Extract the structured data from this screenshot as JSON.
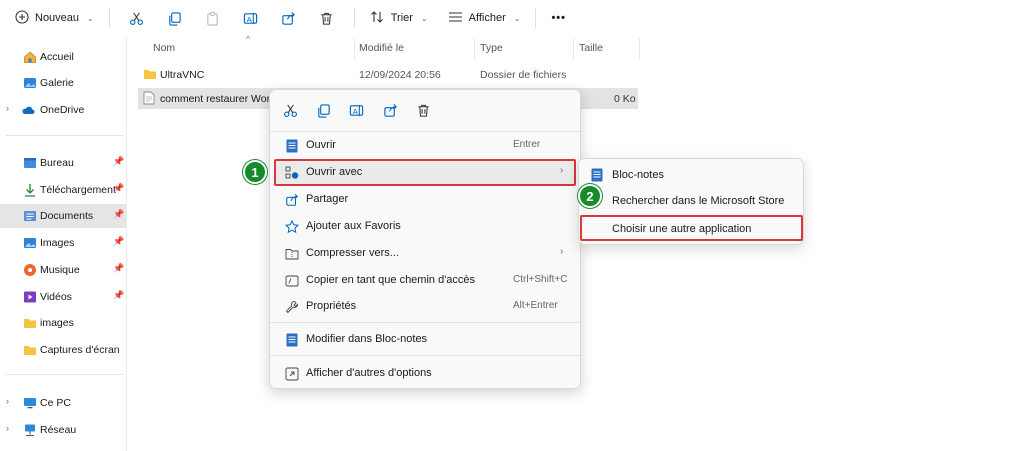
{
  "toolbar": {
    "new_label": "Nouveau",
    "sort_label": "Trier",
    "view_label": "Afficher",
    "more_label": "•••",
    "icons": [
      "cut-icon",
      "copy-icon",
      "paste-icon",
      "rename-icon",
      "share-icon",
      "delete-icon"
    ]
  },
  "sidebar": {
    "items": [
      {
        "label": "Accueil",
        "icon": "home-icon"
      },
      {
        "label": "Galerie",
        "icon": "gallery-icon"
      },
      {
        "label": "OneDrive",
        "icon": "cloud-icon"
      },
      {
        "label": "Bureau",
        "icon": "desktop-folder-icon"
      },
      {
        "label": "Téléchargement",
        "icon": "download-icon"
      },
      {
        "label": "Documents",
        "icon": "documents-icon"
      },
      {
        "label": "Images",
        "icon": "pictures-icon"
      },
      {
        "label": "Musique",
        "icon": "music-icon"
      },
      {
        "label": "Vidéos",
        "icon": "videos-icon"
      },
      {
        "label": "images",
        "icon": "folder-icon"
      },
      {
        "label": "Captures d'écran",
        "icon": "folder-icon"
      },
      {
        "label": "Ce PC",
        "icon": "computer-icon"
      },
      {
        "label": "Réseau",
        "icon": "network-icon"
      }
    ]
  },
  "columns": {
    "name": "Nom",
    "modified": "Modifié le",
    "type": "Type",
    "size": "Taille"
  },
  "files": [
    {
      "name": "UltraVNC",
      "modified": "12/09/2024 20:56",
      "type": "Dossier de fichiers",
      "size": ""
    },
    {
      "name": "comment restaurer Word",
      "modified": "",
      "type": "",
      "size": "0 Ko"
    }
  ],
  "context_menu": {
    "items": [
      {
        "label": "Ouvrir",
        "shortcut": "Entrer"
      },
      {
        "label": "Ouvrir avec",
        "shortcut": ""
      },
      {
        "label": "Partager",
        "shortcut": ""
      },
      {
        "label": "Ajouter aux Favoris",
        "shortcut": ""
      },
      {
        "label": "Compresser vers...",
        "shortcut": ""
      },
      {
        "label": "Copier en tant que chemin d'accès",
        "shortcut": "Ctrl+Shift+C"
      },
      {
        "label": "Propriétés",
        "shortcut": "Alt+Entrer"
      },
      {
        "label": "Modifier dans Bloc-notes",
        "shortcut": ""
      },
      {
        "label": "Afficher d'autres d'options",
        "shortcut": ""
      }
    ]
  },
  "submenu": {
    "items": [
      {
        "label": "Bloc-notes"
      },
      {
        "label": "Rechercher dans le Microsoft Store"
      },
      {
        "label": "Choisir une autre application"
      }
    ]
  },
  "badges": {
    "step1": "1",
    "step2": "2"
  },
  "colors": {
    "accent": "#0067c0",
    "highlight_border": "#d9363e",
    "badge": "#178a2c",
    "folder": "#f6c343"
  }
}
